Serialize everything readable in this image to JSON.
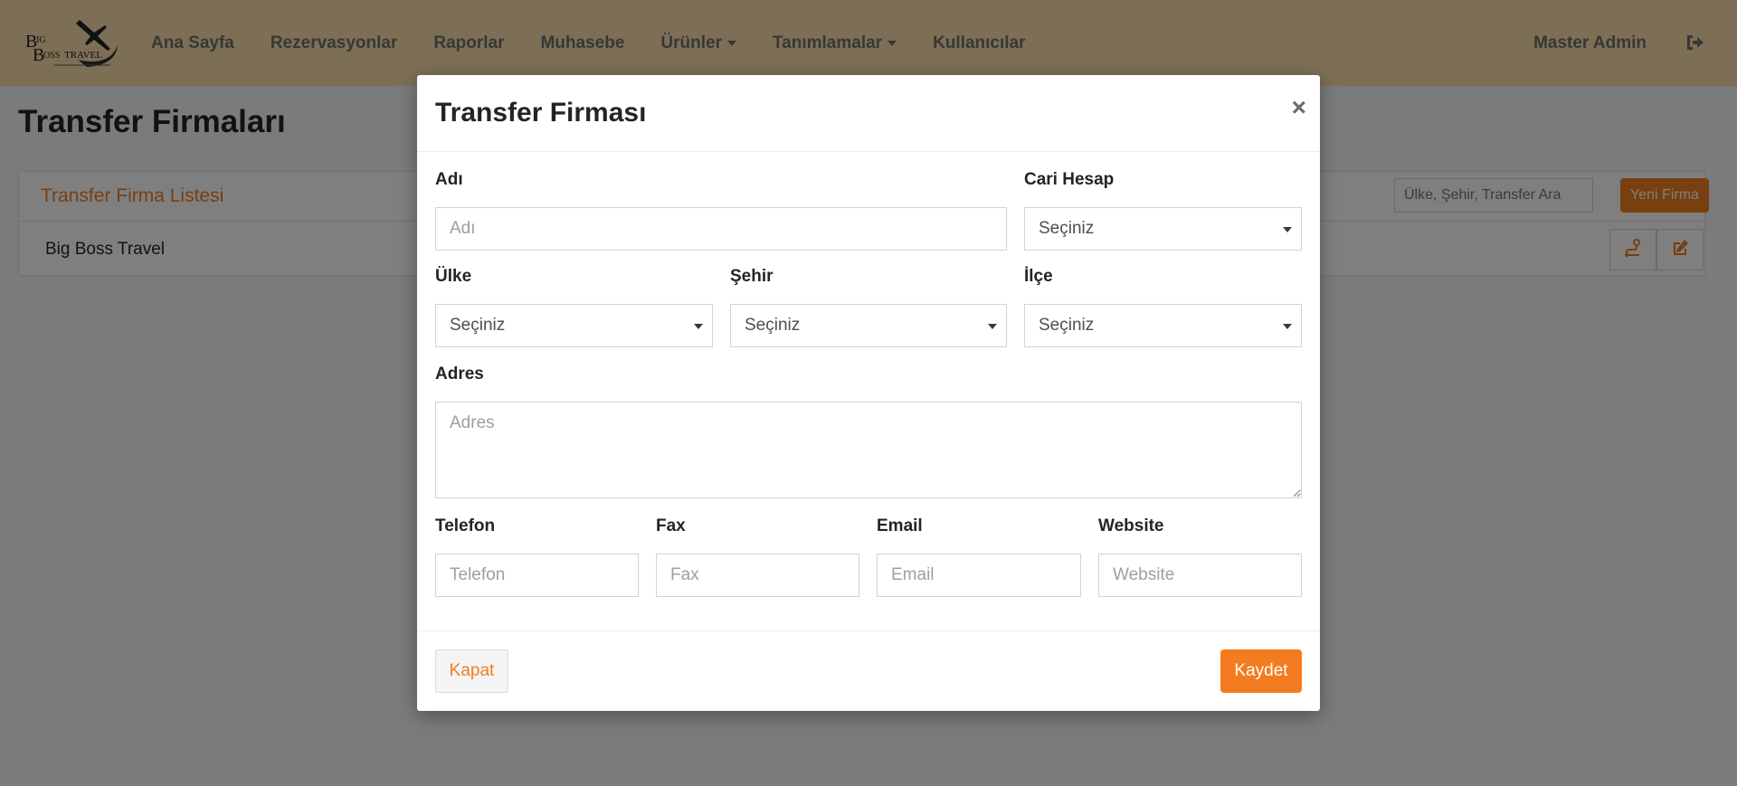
{
  "navbar": {
    "brand_text": "Big Boss Travel",
    "links": [
      {
        "label": "Ana Sayfa",
        "dropdown": false
      },
      {
        "label": "Rezervasyonlar",
        "dropdown": false
      },
      {
        "label": "Raporlar",
        "dropdown": false
      },
      {
        "label": "Muhasebe",
        "dropdown": false
      },
      {
        "label": "Ürünler",
        "dropdown": true
      },
      {
        "label": "Tanımlamalar",
        "dropdown": true
      },
      {
        "label": "Kullanıcılar",
        "dropdown": false
      }
    ],
    "user": "Master Admin",
    "logout_icon": "sign-out-icon"
  },
  "page": {
    "title": "Transfer Firmaları",
    "card_title": "Transfer Firma Listesi",
    "search_placeholder": "Ülke, Şehir, Transfer Ara",
    "new_button": "Yeni Firma",
    "rows": [
      {
        "name": "Big Boss Travel"
      }
    ],
    "row_icons": [
      "route-icon",
      "edit-icon"
    ]
  },
  "modal": {
    "title": "Transfer Firması",
    "close_symbol": "×",
    "fields": {
      "name": {
        "label": "Adı",
        "placeholder": "Adı"
      },
      "account": {
        "label": "Cari Hesap",
        "value": "Seçiniz"
      },
      "country": {
        "label": "Ülke",
        "value": "Seçiniz"
      },
      "city": {
        "label": "Şehir",
        "value": "Seçiniz"
      },
      "district": {
        "label": "İlçe",
        "value": "Seçiniz"
      },
      "address": {
        "label": "Adres",
        "placeholder": "Adres"
      },
      "phone": {
        "label": "Telefon",
        "placeholder": "Telefon"
      },
      "fax": {
        "label": "Fax",
        "placeholder": "Fax"
      },
      "email": {
        "label": "Email",
        "placeholder": "Email"
      },
      "website": {
        "label": "Website",
        "placeholder": "Website"
      }
    },
    "close_button": "Kapat",
    "save_button": "Kaydet"
  },
  "colors": {
    "navbar_bg": "#fbdfaa",
    "accent": "#f07f1e",
    "backdrop": "rgba(0,0,0,0.5)"
  }
}
